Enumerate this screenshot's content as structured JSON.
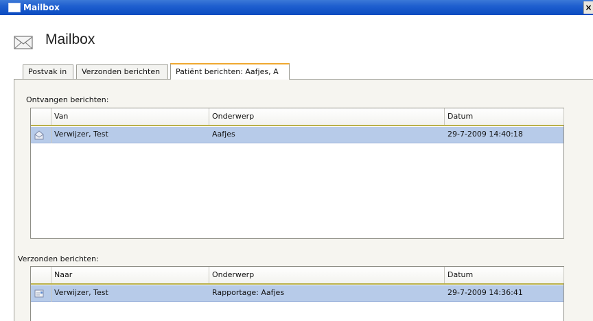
{
  "window": {
    "title": "Mailbox",
    "close_glyph": "×"
  },
  "header": {
    "title": "Mailbox",
    "icon": "envelope-icon"
  },
  "tabs": [
    {
      "label": "Postvak in",
      "active": false
    },
    {
      "label": "Verzonden berichten",
      "active": false
    },
    {
      "label": "Patiënt berichten: Aafjes, A",
      "active": true
    }
  ],
  "received": {
    "label": "Ontvangen berichten:",
    "columns": [
      "Van",
      "Onderwerp",
      "Datum"
    ],
    "rows": [
      {
        "icon": "open-envelope-icon",
        "from": "Verwijzer, Test",
        "subject": "Aafjes",
        "date": "29-7-2009 14:40:18"
      }
    ]
  },
  "sent": {
    "label": "Verzonden berichten:",
    "columns": [
      "Naar",
      "Onderwerp",
      "Datum"
    ],
    "rows": [
      {
        "icon": "sent-mail-icon",
        "to": "Verwijzer, Test",
        "subject": "Rapportage: Aafjes",
        "date": "29-7-2009 14:36:41"
      }
    ]
  },
  "colors": {
    "titlebar": "#0a4bc0",
    "selected_row": "#b7cbe9",
    "active_tab_accent": "#f0a830",
    "header_underline": "#b9b04a"
  }
}
